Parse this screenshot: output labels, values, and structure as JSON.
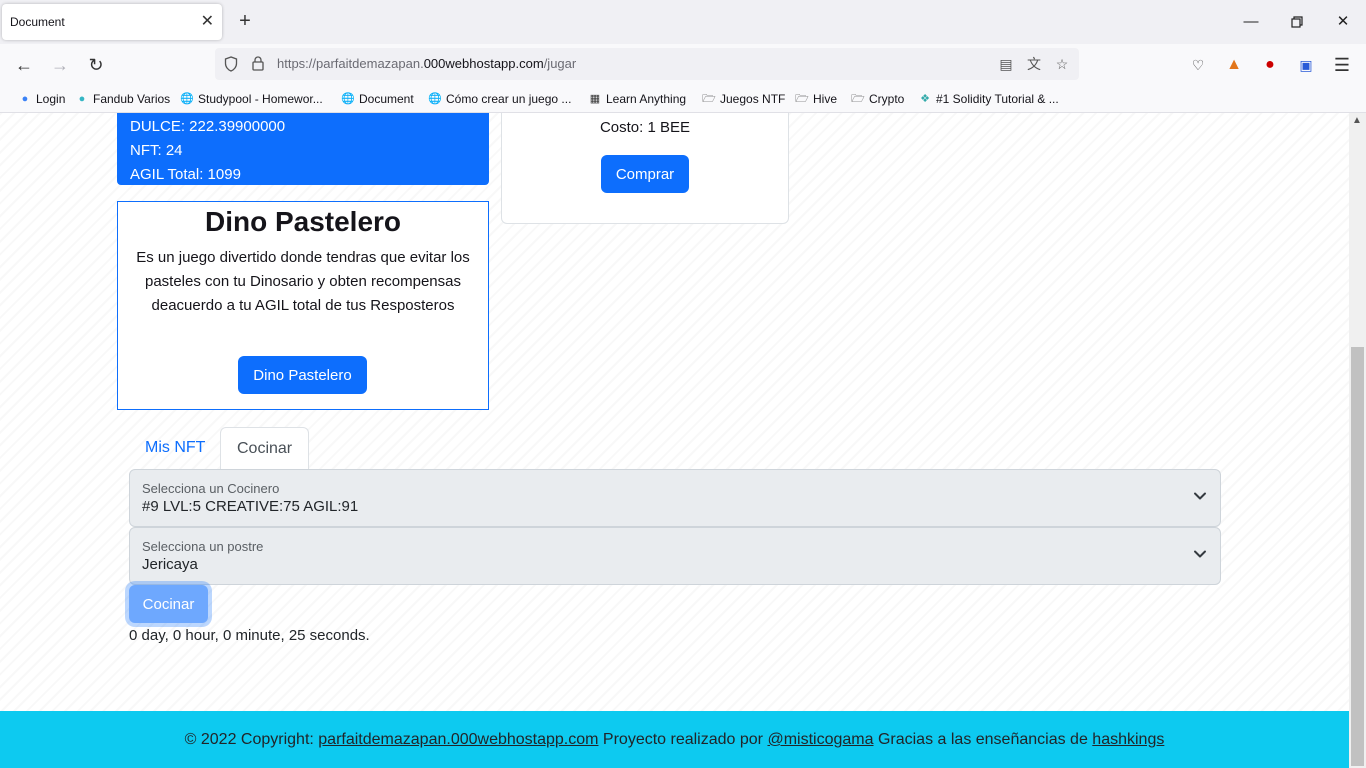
{
  "browser": {
    "tab_title": "Document",
    "url_prefix": "https://parfaitdemazapan.",
    "url_host": "000webhostapp.com",
    "url_path": "/jugar",
    "bookmarks": [
      {
        "label": "Login",
        "icon": "blue-dot-icon"
      },
      {
        "label": "Fandub Varios",
        "icon": "fandub-icon"
      },
      {
        "label": "Studypool - Homewor...",
        "icon": "globe-icon"
      },
      {
        "label": "Document",
        "icon": "globe-icon"
      },
      {
        "label": "Cómo crear un juego ...",
        "icon": "globe-icon"
      },
      {
        "label": "Learn Anything",
        "icon": "map-icon"
      },
      {
        "label": "Juegos NTF",
        "icon": "folder-icon"
      },
      {
        "label": "Hive",
        "icon": "folder-icon"
      },
      {
        "label": "Crypto",
        "icon": "folder-icon"
      },
      {
        "label": "#1 Solidity Tutorial & ...",
        "icon": "solidity-icon"
      }
    ]
  },
  "stats": {
    "dulce": "DULCE: 222.39900000",
    "nft": "NFT: 24",
    "agil_total": "AGIL Total: 1099"
  },
  "buy_card": {
    "cost": "Costo: 1 BEE",
    "button": "Comprar"
  },
  "dino_card": {
    "title": "Dino Pastelero",
    "description": "Es un juego divertido donde tendras que evitar los pasteles con tu Dinosario y obten recompensas deacuerdo a tu AGIL total de tus Resposteros",
    "button": "Dino Pastelero"
  },
  "tabs": [
    {
      "label": "Mis NFT",
      "active": false
    },
    {
      "label": "Cocinar",
      "active": true
    }
  ],
  "cook_form": {
    "cocinero_label": "Selecciona un Cocinero",
    "cocinero_value": "#9 LVL:5 CREATIVE:75 AGIL:91",
    "postre_label": "Selecciona un postre",
    "postre_value": "Jericaya",
    "button": "Cocinar",
    "timer": "0 day, 0 hour, 0 minute, 25 seconds."
  },
  "footer": {
    "prefix": "© 2022 Copyright: ",
    "site_link": "parfaitdemazapan.000webhostapp.com",
    "middle": " Proyecto realizado por ",
    "author_link": "@misticogama",
    "thanks": " Gracias a las enseñancias de ",
    "thanks_link": "hashkings"
  },
  "colors": {
    "primary": "#0d6efd",
    "footer_bg": "#0dcaf0",
    "cook_button_focus": "#6ea8fe"
  }
}
